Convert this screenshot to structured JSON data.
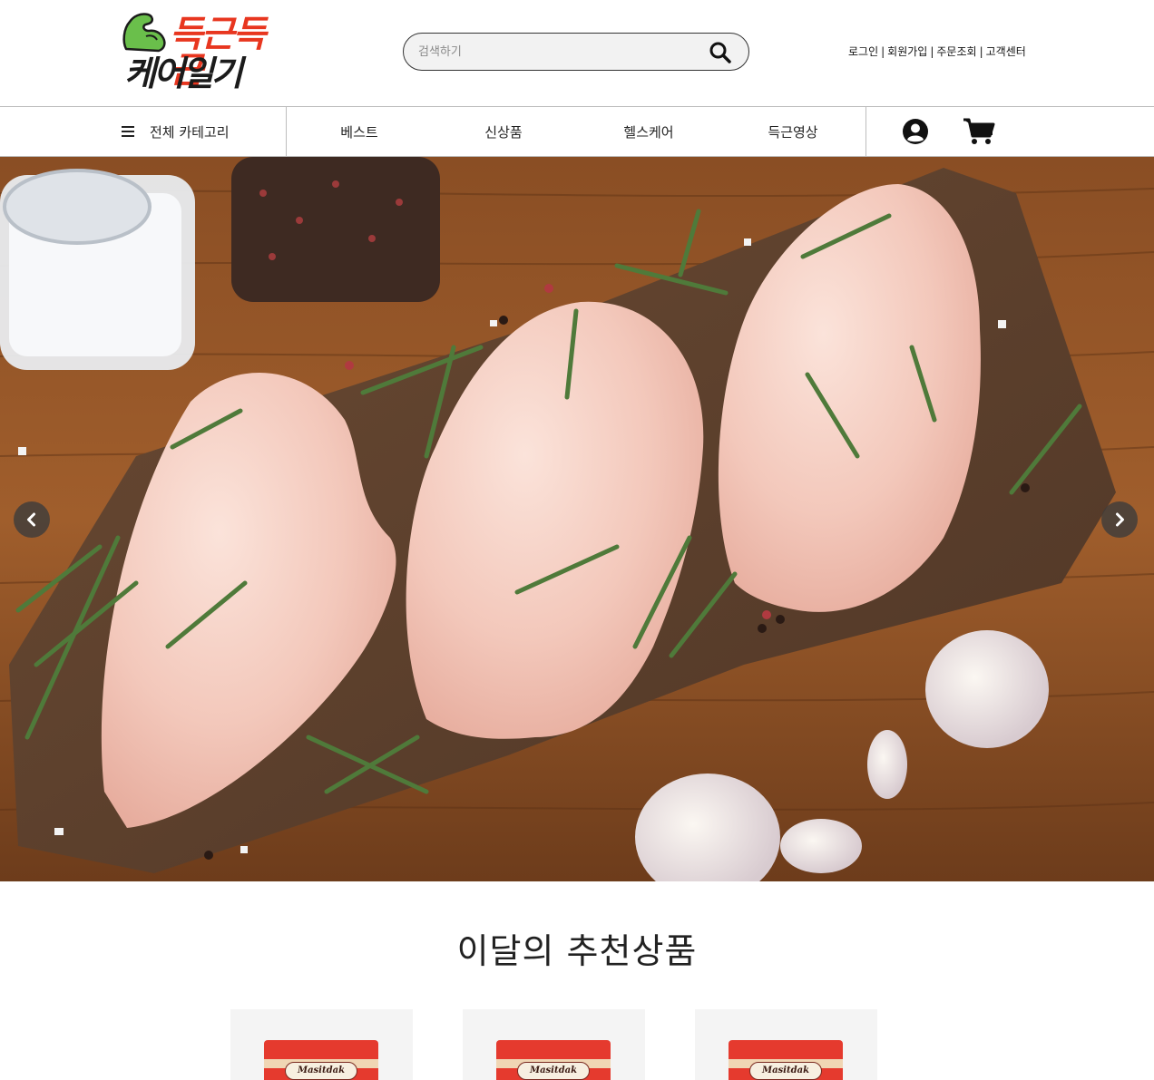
{
  "header": {
    "logo": {
      "line1": "득근득근",
      "line2": "케어일기"
    },
    "search": {
      "placeholder": "검색하기"
    },
    "util_links": [
      "로그인",
      "회원가입",
      "주문조회",
      "고객센터"
    ]
  },
  "nav": {
    "all_categories": "전체 카테고리",
    "items": [
      "베스트",
      "신상품",
      "헬스케어",
      "득근영상"
    ]
  },
  "hero": {
    "description": "",
    "prev_icon": "chevron-left-icon",
    "next_icon": "chevron-right-icon"
  },
  "recommend": {
    "title": "이달의 추천상품",
    "products": [
      {
        "brand": "Masitdak"
      },
      {
        "brand": "Masitdak"
      },
      {
        "brand": "Masitdak"
      }
    ]
  },
  "colors": {
    "logo_red": "#e8361f",
    "logo_green": "#6abf4b",
    "border": "#bdbdbd",
    "pack_red": "#e53a2e"
  }
}
